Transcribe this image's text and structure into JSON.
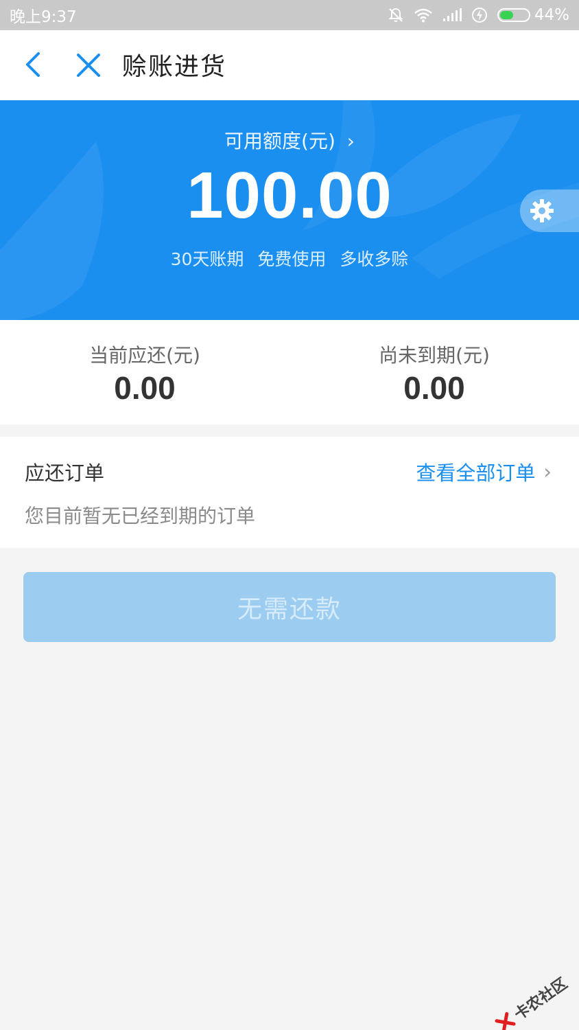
{
  "status_bar": {
    "time": "晚上9:37",
    "battery": "44%",
    "battery_level": 0.44,
    "battery_color": "#39d353"
  },
  "nav": {
    "title": "赊账进货",
    "back_icon": "chevron-left-icon",
    "close_icon": "close-icon"
  },
  "hero": {
    "credit_label": "可用额度(元)",
    "chevron": "›",
    "credit_amount": "100.00",
    "features": [
      "30天账期",
      "免费使用",
      "多收多赊"
    ],
    "bg_color": "#1a8ff0",
    "settings_icon": "gear-icon"
  },
  "summary": {
    "current_due_label": "当前应还(元)",
    "current_due_value": "0.00",
    "not_due_label": "尚未到期(元)",
    "not_due_value": "0.00"
  },
  "orders": {
    "title": "应还订单",
    "view_all": "查看全部订单",
    "chevron": "›",
    "empty_text": "您目前暂无已经到期的订单"
  },
  "repay_button": {
    "label": "无需还款"
  },
  "watermark": {
    "text": "卡农社区"
  }
}
